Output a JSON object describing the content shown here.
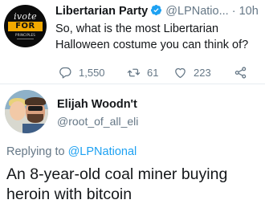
{
  "original_tweet": {
    "author_name": "Libertarian Party",
    "verified": true,
    "handle": "@LPNatio...",
    "separator": "·",
    "time": "10h",
    "text": "So, what is the most Libertarian Halloween costume you can think of?",
    "avatar": {
      "line1": "ivote",
      "line2": "FOR",
      "line3": "PRINCIPLES"
    },
    "actions": {
      "reply_icon": "reply-icon",
      "reply_count": "1,550",
      "retweet_icon": "retweet-icon",
      "retweet_count": "61",
      "like_icon": "heart-icon",
      "like_count": "223",
      "share_icon": "share-icon"
    }
  },
  "reply_tweet": {
    "author_name": "Elijah Woodn't",
    "handle": "@root_of_all_eli",
    "replying_prefix": "Replying to",
    "replying_to": "@LPNational",
    "text": "An 8-year-old coal miner buying heroin with bitcoin"
  },
  "colors": {
    "text_primary": "#14171a",
    "text_secondary": "#657786",
    "link_blue": "#1da1f2",
    "verified_blue": "#1da1f2",
    "divider": "#e6ecf0"
  }
}
